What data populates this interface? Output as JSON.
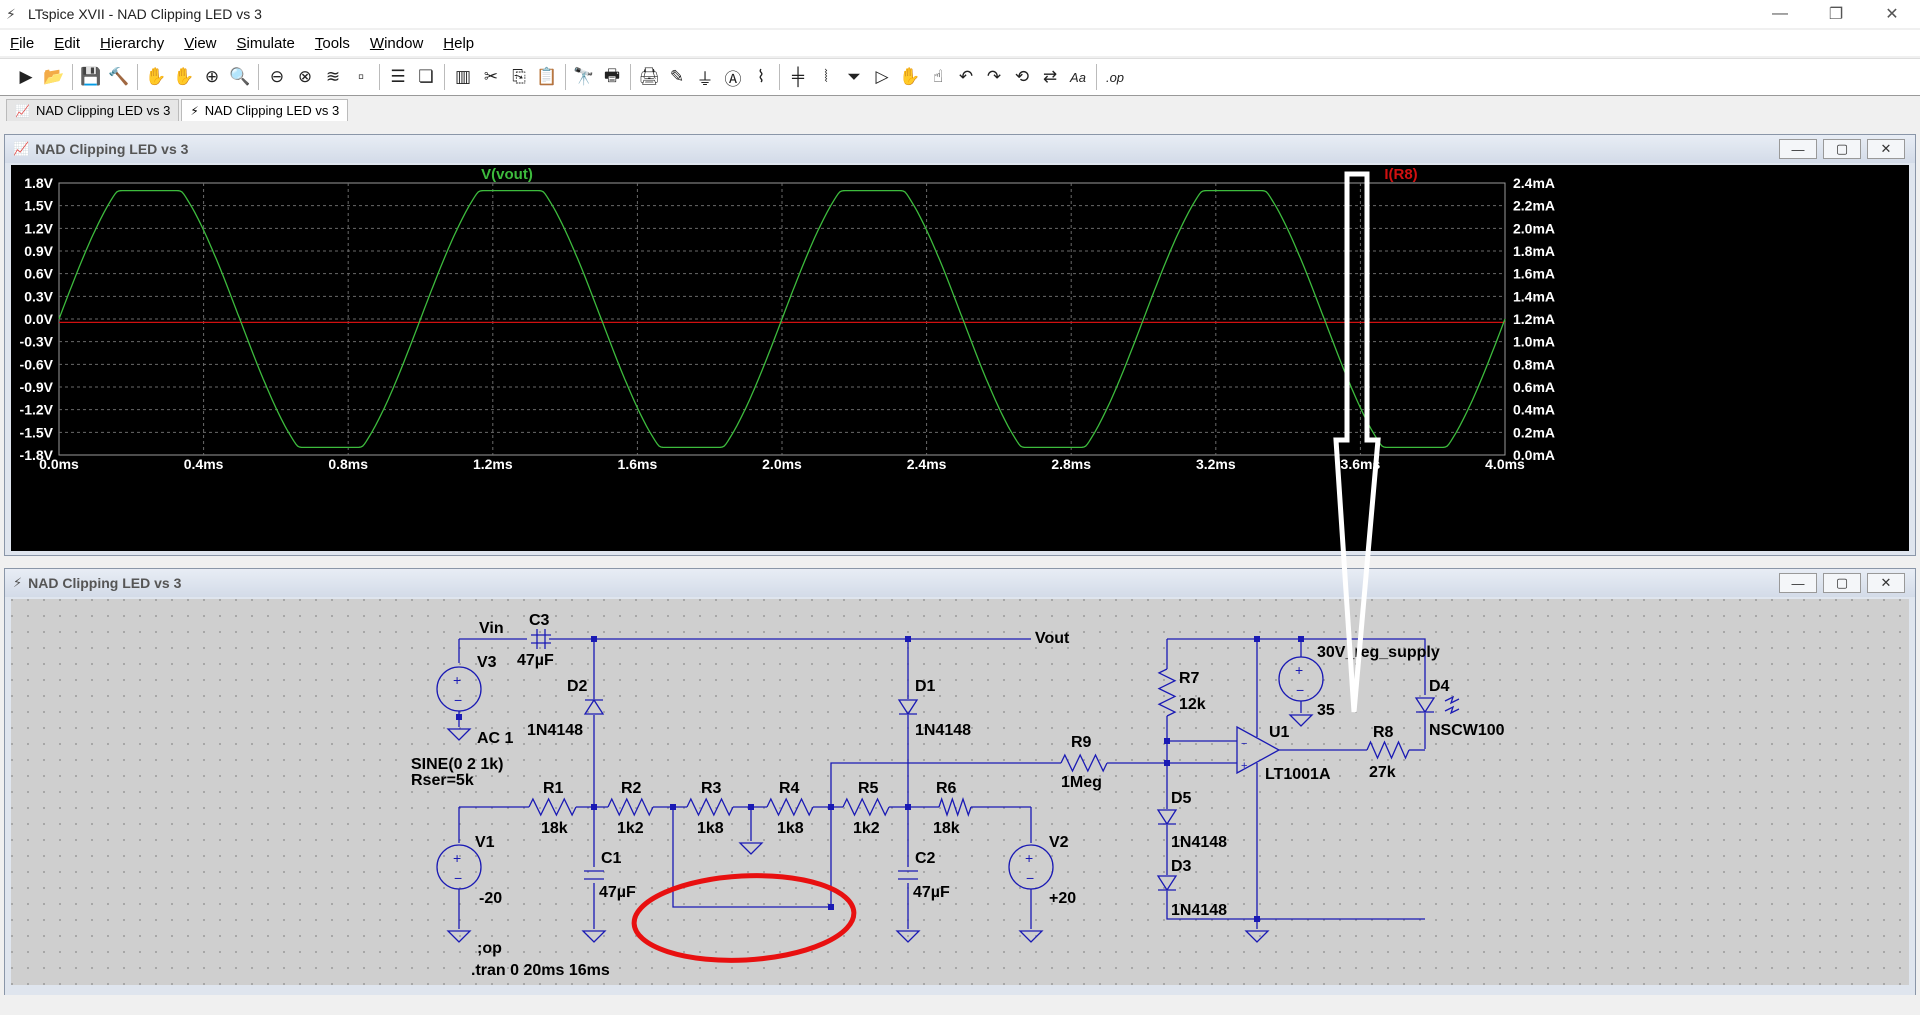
{
  "window": {
    "title": "LTspice XVII - NAD Clipping LED vs 3",
    "minimize": "—",
    "restore": "❐",
    "close": "✕"
  },
  "menu": [
    "File",
    "Edit",
    "Hierarchy",
    "View",
    "Simulate",
    "Tools",
    "Window",
    "Help"
  ],
  "toolbar_icons": [
    "run-icon",
    "open-icon",
    "save-icon",
    "control-panel-icon",
    "halt-icon",
    "pan-icon",
    "zoom-in-icon",
    "zoom-back-icon",
    "zoom-out-icon",
    "zoom-full-icon",
    "autorange-icon",
    "erase-icon",
    "tile-horizontal-icon",
    "cascade-icon",
    "tile-vertical-icon",
    "cut-icon",
    "copy-icon",
    "paste-icon",
    "find-icon",
    "print-icon",
    "print-setup-icon",
    "wire-icon",
    "ground-icon",
    "label-icon",
    "resistor-icon",
    "capacitor-icon",
    "inductor-icon",
    "diode-icon",
    "component-icon",
    "move-icon",
    "drag-icon",
    "undo-icon",
    "redo-icon",
    "rotate-icon",
    "mirror-icon",
    "text-icon",
    "spice-directive-icon"
  ],
  "tabs": [
    {
      "label": "NAD Clipping LED vs 3",
      "icon": "waveform-icon"
    },
    {
      "label": "NAD Clipping LED vs 3",
      "icon": "schematic-icon"
    }
  ],
  "waveform_window": {
    "title": "NAD Clipping LED vs 3"
  },
  "schematic_window": {
    "title": "NAD Clipping LED vs 3"
  },
  "colors": {
    "trace_vout": "#3dbb3d",
    "trace_ir8": "#d01010",
    "plot_bg": "#000000",
    "wire": "#1a1ab4",
    "annotation": "#e81010"
  },
  "chart_data": {
    "type": "line",
    "x_ticks": [
      "0.0ms",
      "0.4ms",
      "0.8ms",
      "1.2ms",
      "1.6ms",
      "2.0ms",
      "2.4ms",
      "2.8ms",
      "3.2ms",
      "3.6ms",
      "4.0ms"
    ],
    "y_left_ticks": [
      "1.8V",
      "1.5V",
      "1.2V",
      "0.9V",
      "0.6V",
      "0.3V",
      "0.0V",
      "-0.3V",
      "-0.6V",
      "-0.9V",
      "-1.2V",
      "-1.5V",
      "-1.8V"
    ],
    "y_right_ticks": [
      "2.4mA",
      "2.2mA",
      "2.0mA",
      "1.8mA",
      "1.6mA",
      "1.4mA",
      "1.2mA",
      "1.0mA",
      "0.8mA",
      "0.6mA",
      "0.4mA",
      "0.2mA",
      "0.0mA"
    ],
    "xlim": [
      0,
      4.0
    ],
    "ylim_left": [
      -1.8,
      1.8
    ],
    "ylim_right": [
      0,
      2.4
    ],
    "grid": true,
    "series": [
      {
        "name": "V(vout)",
        "axis": "left",
        "shape": "clipped-sine",
        "frequency_khz": 1,
        "amplitude": 1.7,
        "clip_level": 1.65
      },
      {
        "name": "I(R8)",
        "axis": "right",
        "shape": "constant",
        "value": 1.17
      }
    ]
  },
  "schematic": {
    "labels": {
      "vin": "Vin",
      "vout": "Vout",
      "c3": "C3",
      "c3_val": "47µF",
      "v3": "V3",
      "v3_ac": "AC 1",
      "v3_sine": "SINE(0 2 1k)",
      "v3_rser": "Rser=5k",
      "d2": "D2",
      "d2_val": "1N4148",
      "d1": "D1",
      "d1_val": "1N4148",
      "r1": "R1",
      "r1_val": "18k",
      "r2": "R2",
      "r2_val": "1k2",
      "r3": "R3",
      "r3_val": "1k8",
      "r4": "R4",
      "r4_val": "1k8",
      "r5": "R5",
      "r5_val": "1k2",
      "r6": "R6",
      "r6_val": "18k",
      "r9": "R9",
      "r9_val": "1Meg",
      "r7": "R7",
      "r7_val": "12k",
      "r8": "R8",
      "r8_val": "27k",
      "c1": "C1",
      "c1_val": "47µF",
      "c2": "C2",
      "c2_val": "47µF",
      "v1": "V1",
      "v1_val": "-20",
      "v2": "V2",
      "v2_val": "+20",
      "supply": "30V_reg_supply",
      "supply_val": "35",
      "d4": "D4",
      "d4_val": "NSCW100",
      "u1": "U1",
      "u1_val": "LT1001A",
      "d5": "D5",
      "d5_val": "1N4148",
      "d3": "D3",
      "d3_val": "1N4148",
      "op": ";op",
      "tran": ".tran 0 20ms 16ms"
    }
  }
}
